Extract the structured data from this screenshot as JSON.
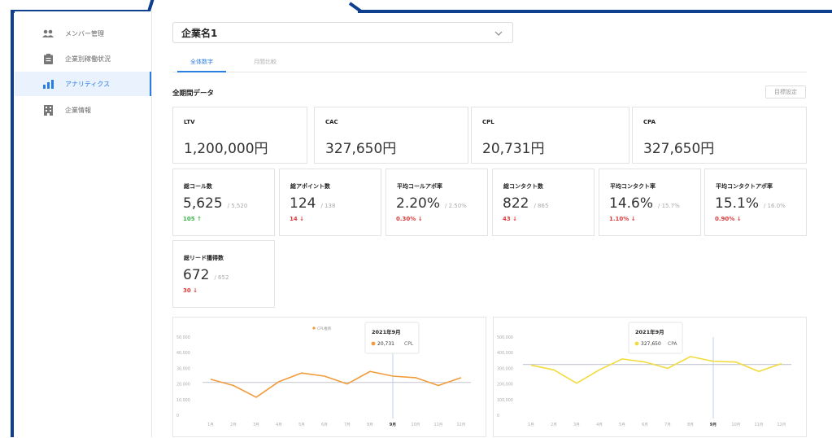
{
  "sidebar": {
    "items": [
      {
        "label": "メンバー管理",
        "icon": "people-icon",
        "active": false
      },
      {
        "label": "企業別稼働状況",
        "icon": "clipboard-icon",
        "active": false
      },
      {
        "label": "アナリティクス",
        "icon": "bar-chart-icon",
        "active": true
      },
      {
        "label": "企業情報",
        "icon": "building-icon",
        "active": false
      }
    ]
  },
  "header": {
    "company": "企業名1",
    "tabs": [
      {
        "label": "全体数字",
        "active": true
      },
      {
        "label": "月間比較",
        "active": false
      }
    ]
  },
  "section": {
    "title": "全期間データ",
    "goal_button": "目標設定"
  },
  "kpi_big": [
    {
      "label": "LTV",
      "value": "1,200,000円"
    },
    {
      "label": "CAC",
      "value": "327,650円"
    },
    {
      "label": "CPL",
      "value": "20,731円"
    },
    {
      "label": "CPA",
      "value": "327,650円"
    }
  ],
  "kpi_small": [
    {
      "label": "総コール数",
      "value": "5,625",
      "target": "/ 5,520",
      "delta": "105 ↑",
      "trend": "up"
    },
    {
      "label": "総アポイント数",
      "value": "124",
      "target": "/ 138",
      "delta": "14 ↓",
      "trend": "down"
    },
    {
      "label": "平均コールアポ率",
      "value": "2.20%",
      "target": "/ 2.50%",
      "delta": "0.30% ↓",
      "trend": "down"
    },
    {
      "label": "総コンタクト数",
      "value": "822",
      "target": "/ 865",
      "delta": "43 ↓",
      "trend": "down"
    },
    {
      "label": "平均コンタクト率",
      "value": "14.6%",
      "target": "/ 15.7%",
      "delta": "1.10% ↓",
      "trend": "down"
    },
    {
      "label": "平均コンタクトアポ率",
      "value": "15.1%",
      "target": "/ 16.0%",
      "delta": "0.90% ↓",
      "trend": "down"
    },
    {
      "label": "総リード獲得数",
      "value": "672",
      "target": "/ 652",
      "delta": "30 ↓",
      "trend": "down"
    }
  ],
  "colors": {
    "accent": "#2a7ee0",
    "up": "#3ab54a",
    "down": "#e03a3a",
    "cpl_line": "#f29b3b",
    "cpa_line": "#f2dc3b",
    "avg_line": "#c9cbd6",
    "frame": "#0f3f8f"
  },
  "chart_data": [
    {
      "type": "line",
      "title": "",
      "legend": "CPL推移",
      "categories": [
        "1月",
        "2月",
        "3月",
        "4月",
        "5月",
        "6月",
        "7月",
        "8月",
        "9月",
        "10月",
        "11月",
        "12月"
      ],
      "series": [
        {
          "name": "CPL推移",
          "values": [
            23000,
            19000,
            11500,
            21500,
            27000,
            25000,
            20000,
            28000,
            25000,
            24000,
            19000,
            24000
          ]
        }
      ],
      "average": 21000,
      "ylim": [
        0,
        50000
      ],
      "yticks": [
        "50,000",
        "40,000",
        "30,000",
        "20,000",
        "10,000",
        "0"
      ],
      "highlight": {
        "category": "9月",
        "title": "2021年9月",
        "value": "20,731",
        "series": "CPL"
      }
    },
    {
      "type": "line",
      "title": "",
      "legend": "CPA推移",
      "categories": [
        "1月",
        "2月",
        "3月",
        "4月",
        "5月",
        "6月",
        "7月",
        "8月",
        "9月",
        "10月",
        "11月",
        "12月"
      ],
      "series": [
        {
          "name": "CPA推移",
          "values": [
            320000,
            290000,
            205000,
            290000,
            360000,
            340000,
            300000,
            375000,
            345000,
            340000,
            280000,
            330000
          ]
        }
      ],
      "average": 325000,
      "ylim": [
        0,
        500000
      ],
      "yticks": [
        "500,000",
        "400,000",
        "300,000",
        "200,000",
        "100,000",
        "0"
      ],
      "highlight": {
        "category": "9月",
        "title": "2021年9月",
        "value": "327,650",
        "series": "CPA"
      }
    }
  ]
}
